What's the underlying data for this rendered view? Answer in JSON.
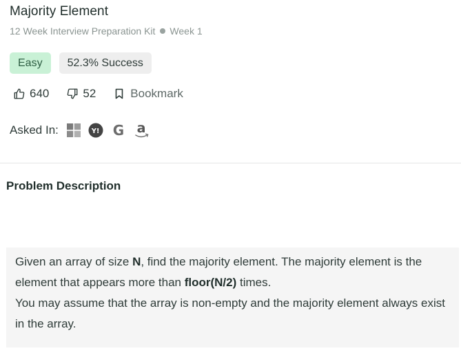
{
  "problem": {
    "title": "Majority Element",
    "breadcrumb": {
      "kit": "12 Week Interview Preparation Kit",
      "week": "Week 1"
    },
    "difficulty": "Easy",
    "success_rate": "52.3% Success",
    "likes": "640",
    "dislikes": "52",
    "bookmark_label": "Bookmark",
    "asked_in_label": "Asked In:",
    "companies": [
      "microsoft-icon",
      "yahoo-icon",
      "google-icon",
      "amazon-icon"
    ]
  },
  "description": {
    "heading": "Problem Description",
    "p1_before": "Given an array of size ",
    "p1_bold1": "N",
    "p1_mid": ", find the majority element. The majority element is the element that appears more than ",
    "p1_bold2": "floor(N/2)",
    "p1_after": " times.",
    "p2": "You may assume that the array is non-empty and the majority element always exist in the array."
  },
  "colors": {
    "easy_bg": "#c9f1d6",
    "easy_text": "#2e5e43",
    "success_bg": "#eeeeee",
    "description_bg": "#f5f5f5"
  }
}
